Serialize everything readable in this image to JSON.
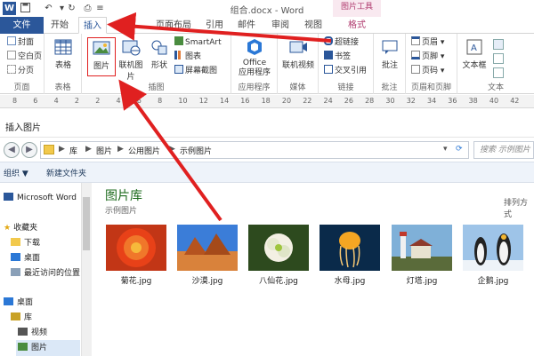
{
  "window": {
    "title": "组合.docx - Word"
  },
  "tabs": [
    {
      "label": "文件"
    },
    {
      "label": "开始"
    },
    {
      "label": "插入"
    },
    {
      "label": "页面布局"
    },
    {
      "label": "引用"
    },
    {
      "label": "邮件"
    },
    {
      "label": "审阅"
    },
    {
      "label": "视图"
    },
    {
      "label": "格式"
    }
  ],
  "contextual_tab": {
    "label": "图片工具"
  },
  "ribbon": {
    "pages": {
      "items": [
        "封面",
        "空白页",
        "分页"
      ],
      "label": "页面"
    },
    "tables": {
      "button": "表格",
      "label": "表格"
    },
    "illustrations": {
      "picture": "图片",
      "online_picture": "联机图片",
      "shapes": "形状",
      "smartart": "SmartArt",
      "chart": "图表",
      "screenshot": "屏幕截图",
      "label": "插图"
    },
    "apps": {
      "button_line1": "Office",
      "button_line2": "应用程序",
      "label": "应用程序"
    },
    "media": {
      "button": "联机视频",
      "label": "媒体"
    },
    "links": {
      "items": [
        "超链接",
        "书签",
        "交叉引用"
      ],
      "label": "链接"
    },
    "comments": {
      "button": "批注",
      "label": "批注"
    },
    "header_footer": {
      "items": [
        "页眉",
        "页脚",
        "页码"
      ],
      "label": "页眉和页脚"
    },
    "text": {
      "button": "文本框",
      "label": "文本"
    }
  },
  "ruler": {
    "ticks": [
      "8",
      "6",
      "4",
      "2",
      "2",
      "4",
      "6",
      "8",
      "10",
      "12",
      "14",
      "16",
      "18",
      "20",
      "22",
      "24",
      "26",
      "28",
      "30",
      "32",
      "34",
      "36",
      "38",
      "40",
      "42"
    ]
  },
  "dialog": {
    "title": "插入图片",
    "breadcrumbs": [
      "库",
      "图片",
      "公用图片",
      "示例图片"
    ],
    "search_placeholder": "搜索 示例图片",
    "toolbar": {
      "organize": "组织 ▼",
      "new_folder": "新建文件夹"
    },
    "nav": [
      {
        "label": "Microsoft Word",
        "icon": "word-icon"
      },
      {
        "label": "收藏夹",
        "icon": "star-icon"
      },
      {
        "label": "下载",
        "icon": "folder-icon"
      },
      {
        "label": "桌面",
        "icon": "desktop-icon"
      },
      {
        "label": "最近访问的位置",
        "icon": "recent-icon"
      },
      {
        "label": "桌面",
        "icon": "desktop-icon"
      },
      {
        "label": "库",
        "icon": "library-icon"
      },
      {
        "label": "视频",
        "icon": "video-icon"
      },
      {
        "label": "图片",
        "icon": "picture-icon"
      }
    ],
    "library_title": "图片库",
    "library_subtitle": "示例图片",
    "arrange_by": "排列方式",
    "files": [
      {
        "name": "菊花.jpg"
      },
      {
        "name": "沙漠.jpg"
      },
      {
        "name": "八仙花.jpg"
      },
      {
        "name": "水母.jpg"
      },
      {
        "name": "灯塔.jpg"
      },
      {
        "name": "企鹅.jpg"
      }
    ]
  },
  "colors": {
    "accent": "#2b579a",
    "annotation": "#e02020",
    "library_title": "#1e6b1e"
  }
}
